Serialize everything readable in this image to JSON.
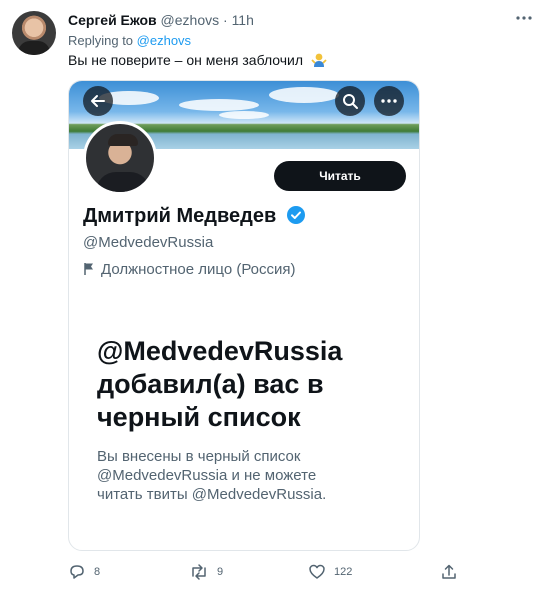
{
  "tweet": {
    "author_name": "Сергей Ежов",
    "author_handle": "@ezhovs",
    "separator": "·",
    "time": "11h",
    "replying_prefix": "Replying to ",
    "replying_to": "@ezhovs",
    "text": "Вы не поверите – он меня заблочил"
  },
  "embedded_profile": {
    "follow_label": "Читать",
    "name": "Дмитрий Медведев",
    "handle": "@MedvedevRussia",
    "label": "Должностное лицо (Россия)",
    "blocked_title_lines": [
      "@MedvedevRussia",
      "добавил(а) вас в",
      "черный список"
    ],
    "blocked_sub_lines": [
      "Вы внесены в черный список",
      "@MedvedevRussia и не можете",
      "читать твиты @MedvedevRussia."
    ]
  },
  "actions": {
    "replies": "8",
    "retweets": "9",
    "likes": "122"
  },
  "colors": {
    "accent": "#1d9bf0",
    "text": "#0f1419",
    "muted": "#536471"
  },
  "icons": [
    "more-icon",
    "shrug-emoji-icon",
    "back-arrow-icon",
    "search-icon",
    "more-horizontal-icon",
    "verified-badge-icon",
    "flag-icon",
    "reply-icon",
    "retweet-icon",
    "like-icon",
    "share-icon"
  ]
}
